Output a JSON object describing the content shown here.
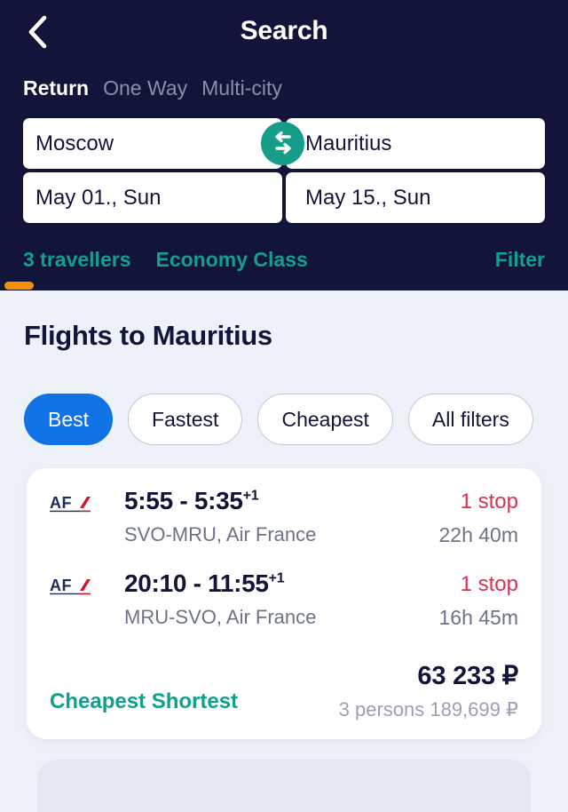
{
  "header": {
    "title": "Search",
    "back_icon": "chevron-left-icon",
    "trip_types": [
      {
        "label": "Return",
        "active": true
      },
      {
        "label": "One Way",
        "active": false
      },
      {
        "label": "Multi-city",
        "active": false
      }
    ],
    "search_form": {
      "origin": "Moscow",
      "destination": "Mauritius",
      "depart_date": "May 01., Sun",
      "return_date": "May 15., Sun",
      "swap_icon": "swap-arrows-icon",
      "swap_color": "#159d8a"
    },
    "options": {
      "travellers": "3 travellers",
      "cabin_class": "Economy Class",
      "filter": "Filter",
      "accent_color": "#11a08c"
    },
    "background_color": "#131439",
    "progress_color": "#f79009"
  },
  "main": {
    "page_title": "Flights to Mauritius",
    "sort_chips": [
      {
        "label": "Best",
        "active": true
      },
      {
        "label": "Fastest",
        "active": false
      },
      {
        "label": "Cheapest",
        "active": false
      },
      {
        "label": "All filters",
        "active": false
      }
    ],
    "active_chip_color": "#1073e6",
    "flight_card": {
      "legs": [
        {
          "airline_logo": "air-france-logo",
          "depart_time": "5:55",
          "arrive_time": "5:35",
          "day_offset": "+1",
          "times": "5:55 - 5:35",
          "route": "SVO-MRU, Air France",
          "stops": "1 stop",
          "duration": "22h 40m"
        },
        {
          "airline_logo": "air-france-logo",
          "depart_time": "20:10",
          "arrive_time": "11:55",
          "day_offset": "+1",
          "times": "20:10 - 11:55",
          "route": "MRU-SVO, Air France",
          "stops": "1 stop",
          "duration": "16h 45m"
        }
      ],
      "badges": "Cheapest Shortest",
      "price": "63 233 ₽",
      "price_note": "3 persons 189,699 ₽",
      "stops_color": "#d63355",
      "badge_color": "#11a08c"
    }
  }
}
